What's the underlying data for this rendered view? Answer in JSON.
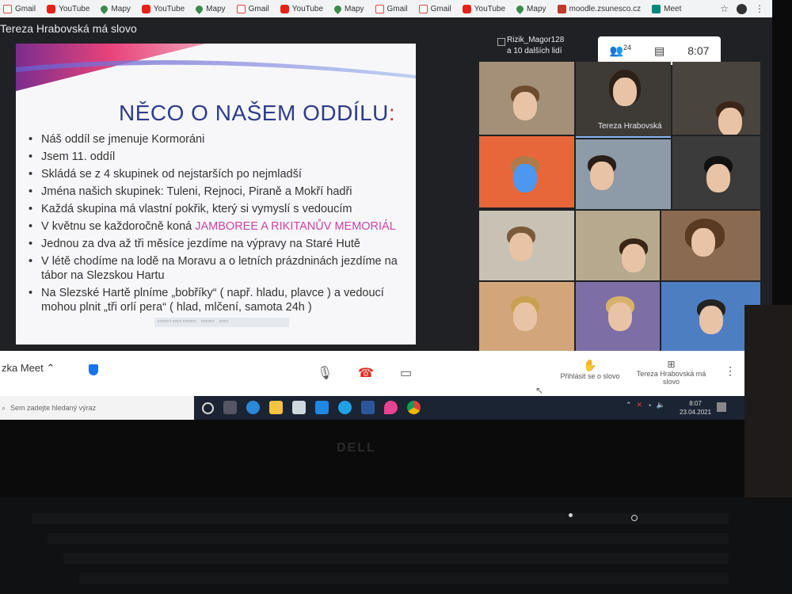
{
  "bookmarks": [
    {
      "label": "Gmail",
      "icon": "gmail-icon",
      "type": "gm"
    },
    {
      "label": "YouTube",
      "icon": "youtube-icon",
      "type": "yt"
    },
    {
      "label": "Mapy",
      "icon": "maps-icon",
      "type": "map"
    },
    {
      "label": "YouTube",
      "icon": "youtube-icon",
      "type": "yt"
    },
    {
      "label": "Mapy",
      "icon": "maps-icon",
      "type": "map"
    },
    {
      "label": "Gmail",
      "icon": "gmail-icon",
      "type": "gm"
    },
    {
      "label": "YouTube",
      "icon": "youtube-icon",
      "type": "yt"
    },
    {
      "label": "Mapy",
      "icon": "maps-icon",
      "type": "map"
    },
    {
      "label": "Gmail",
      "icon": "gmail-icon",
      "type": "gm"
    },
    {
      "label": "Gmail",
      "icon": "gmail-icon",
      "type": "gm"
    },
    {
      "label": "YouTube",
      "icon": "youtube-icon",
      "type": "yt"
    },
    {
      "label": "Mapy",
      "icon": "maps-icon",
      "type": "map"
    },
    {
      "label": "moodle.zsunesco.cz",
      "icon": "moodle-icon",
      "type": "mo"
    },
    {
      "label": "Meet",
      "icon": "meet-icon",
      "type": "meet"
    }
  ],
  "meeting": {
    "title": "Tereza Hrabovská má slovo",
    "presenter_line1": "Rizik_Magor128",
    "presenter_line2": "a 10 dalších lidí",
    "participants_count": "24",
    "time": "8:07"
  },
  "slide": {
    "title": "NĚCO O NAŠEM ODDÍLU",
    "title_colon": ":",
    "bullets": [
      {
        "text": "Náš oddíl se jmenuje Kormoráni",
        "pink": ""
      },
      {
        "text": "Jsem 11. oddíl",
        "pink": ""
      },
      {
        "text": "Skládá se z 4 skupinek od nejstarších po nejmladší",
        "pink": ""
      },
      {
        "text": "Jména našich skupinek: Tuleni, Rejnoci, Piraně a Mokří hadři",
        "pink": ""
      },
      {
        "text": "Každá skupina má vlastní pokřik, který si vymyslí s vedoucím",
        "pink": ""
      },
      {
        "text": "V květnu se každoročně koná ",
        "pink": "JAMBOREE A RIKITANŮV MEMORIÁL"
      },
      {
        "text": "Jednou za dva až tři měsíce jezdíme na výpravy na Staré Hutě",
        "pink": ""
      },
      {
        "text": "V létě chodíme na lodě na Moravu a o letních prázdninách jezdíme na tábor na Slezskou Hartu",
        "pink": ""
      },
      {
        "text": "Na Slezské Hartě plníme „bobříky“ ( např. hladu, plavce ) a vedoucí mohou plnit „tři orlí pera“ ( hlad, mlčení, samota 24h )",
        "pink": ""
      }
    ]
  },
  "grid": {
    "speaker_name": "Tereza Hrabovská"
  },
  "bottom": {
    "meeting_label": "zka Meet",
    "raise_hand": "Přihlásit se o slovo",
    "presenting": "Tereza Hrabovská má slovo"
  },
  "taskbar": {
    "search_placeholder": "Sem zadejte hledaný výraz",
    "clock_time": "8:07",
    "clock_date": "23.04.2021"
  },
  "bezel": {
    "brand": "DELL"
  },
  "colors": {
    "slide_title": "#2f3c8a",
    "accent_pink": "#c844a6",
    "meet_blue": "#1a73e8"
  }
}
